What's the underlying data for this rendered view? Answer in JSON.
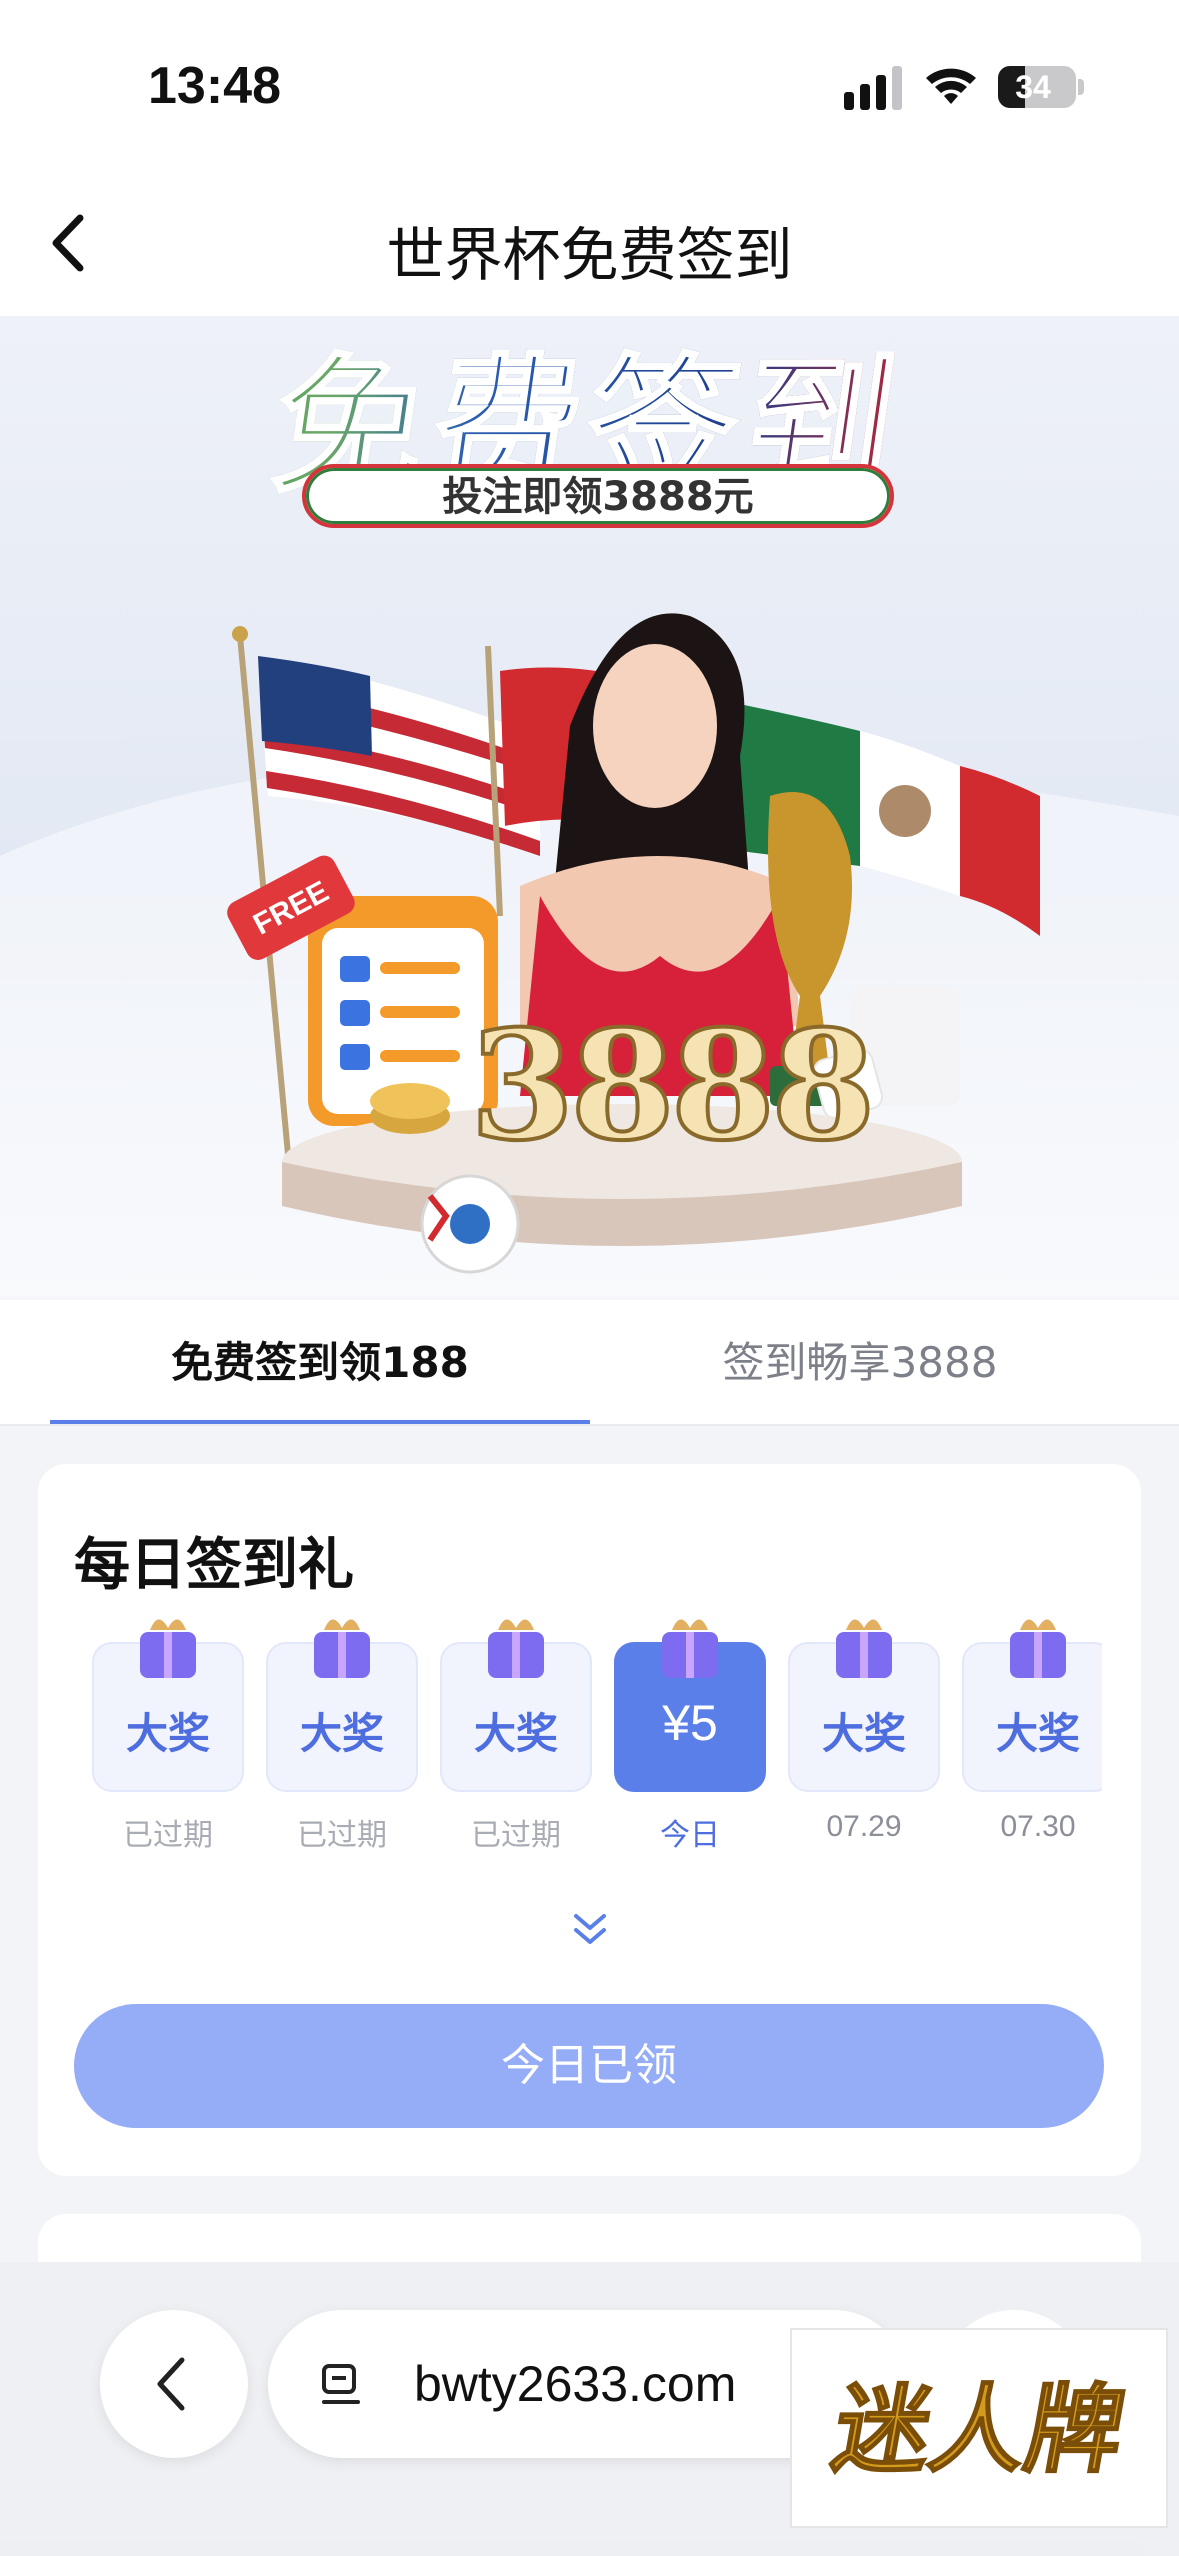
{
  "status_bar": {
    "time": "13:48",
    "battery": "34",
    "battery_level": 0.34
  },
  "header": {
    "title": "世界杯免费签到"
  },
  "hero": {
    "title": "免费签到",
    "subtitle": "投注即领3888元",
    "badge": "FREE",
    "amount": "3888"
  },
  "tabs": [
    {
      "label": "免费签到领188",
      "active": true
    },
    {
      "label": "签到畅享3888",
      "active": false
    }
  ],
  "daily": {
    "title": "每日签到礼",
    "days": [
      {
        "value": "大奖",
        "label": "已过期",
        "active": false
      },
      {
        "value": "大奖",
        "label": "已过期",
        "active": false
      },
      {
        "value": "大奖",
        "label": "已过期",
        "active": false
      },
      {
        "value": "¥5",
        "label": "今日",
        "active": true
      },
      {
        "value": "大奖",
        "label": "07.29",
        "active": false
      },
      {
        "value": "大奖",
        "label": "07.30",
        "active": false
      }
    ],
    "button_label": "今日已领"
  },
  "browser": {
    "url": "bwty2633.com"
  },
  "watermark": "迷人牌",
  "colors": {
    "accent": "#5b7fe8",
    "button_disabled": "#95adf6",
    "tile_bg": "#f2f4fd"
  }
}
